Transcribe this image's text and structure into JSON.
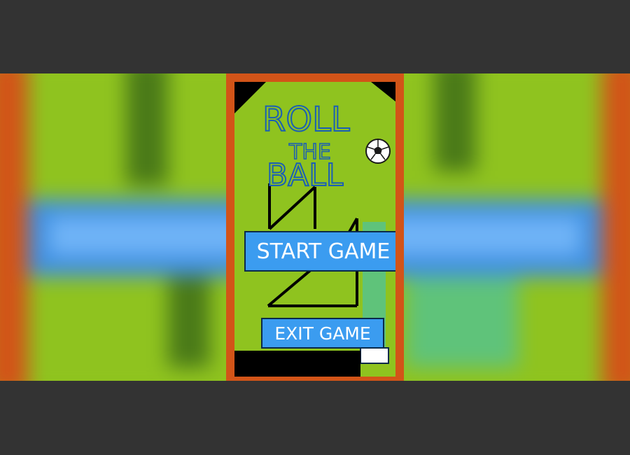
{
  "game": {
    "title_lines": [
      "ROLL",
      "THE",
      "BALL"
    ],
    "menu": {
      "start_label": "START GAME",
      "exit_label": "EXIT GAME"
    }
  },
  "colors": {
    "frame": "#d25418",
    "grass": "#8fc31f",
    "button": "#3b9cf0",
    "title_outline": "#1a5fb4",
    "track_line": "#000000",
    "letterbox": "#333333"
  },
  "icons": [
    "soccer-ball-icon"
  ]
}
